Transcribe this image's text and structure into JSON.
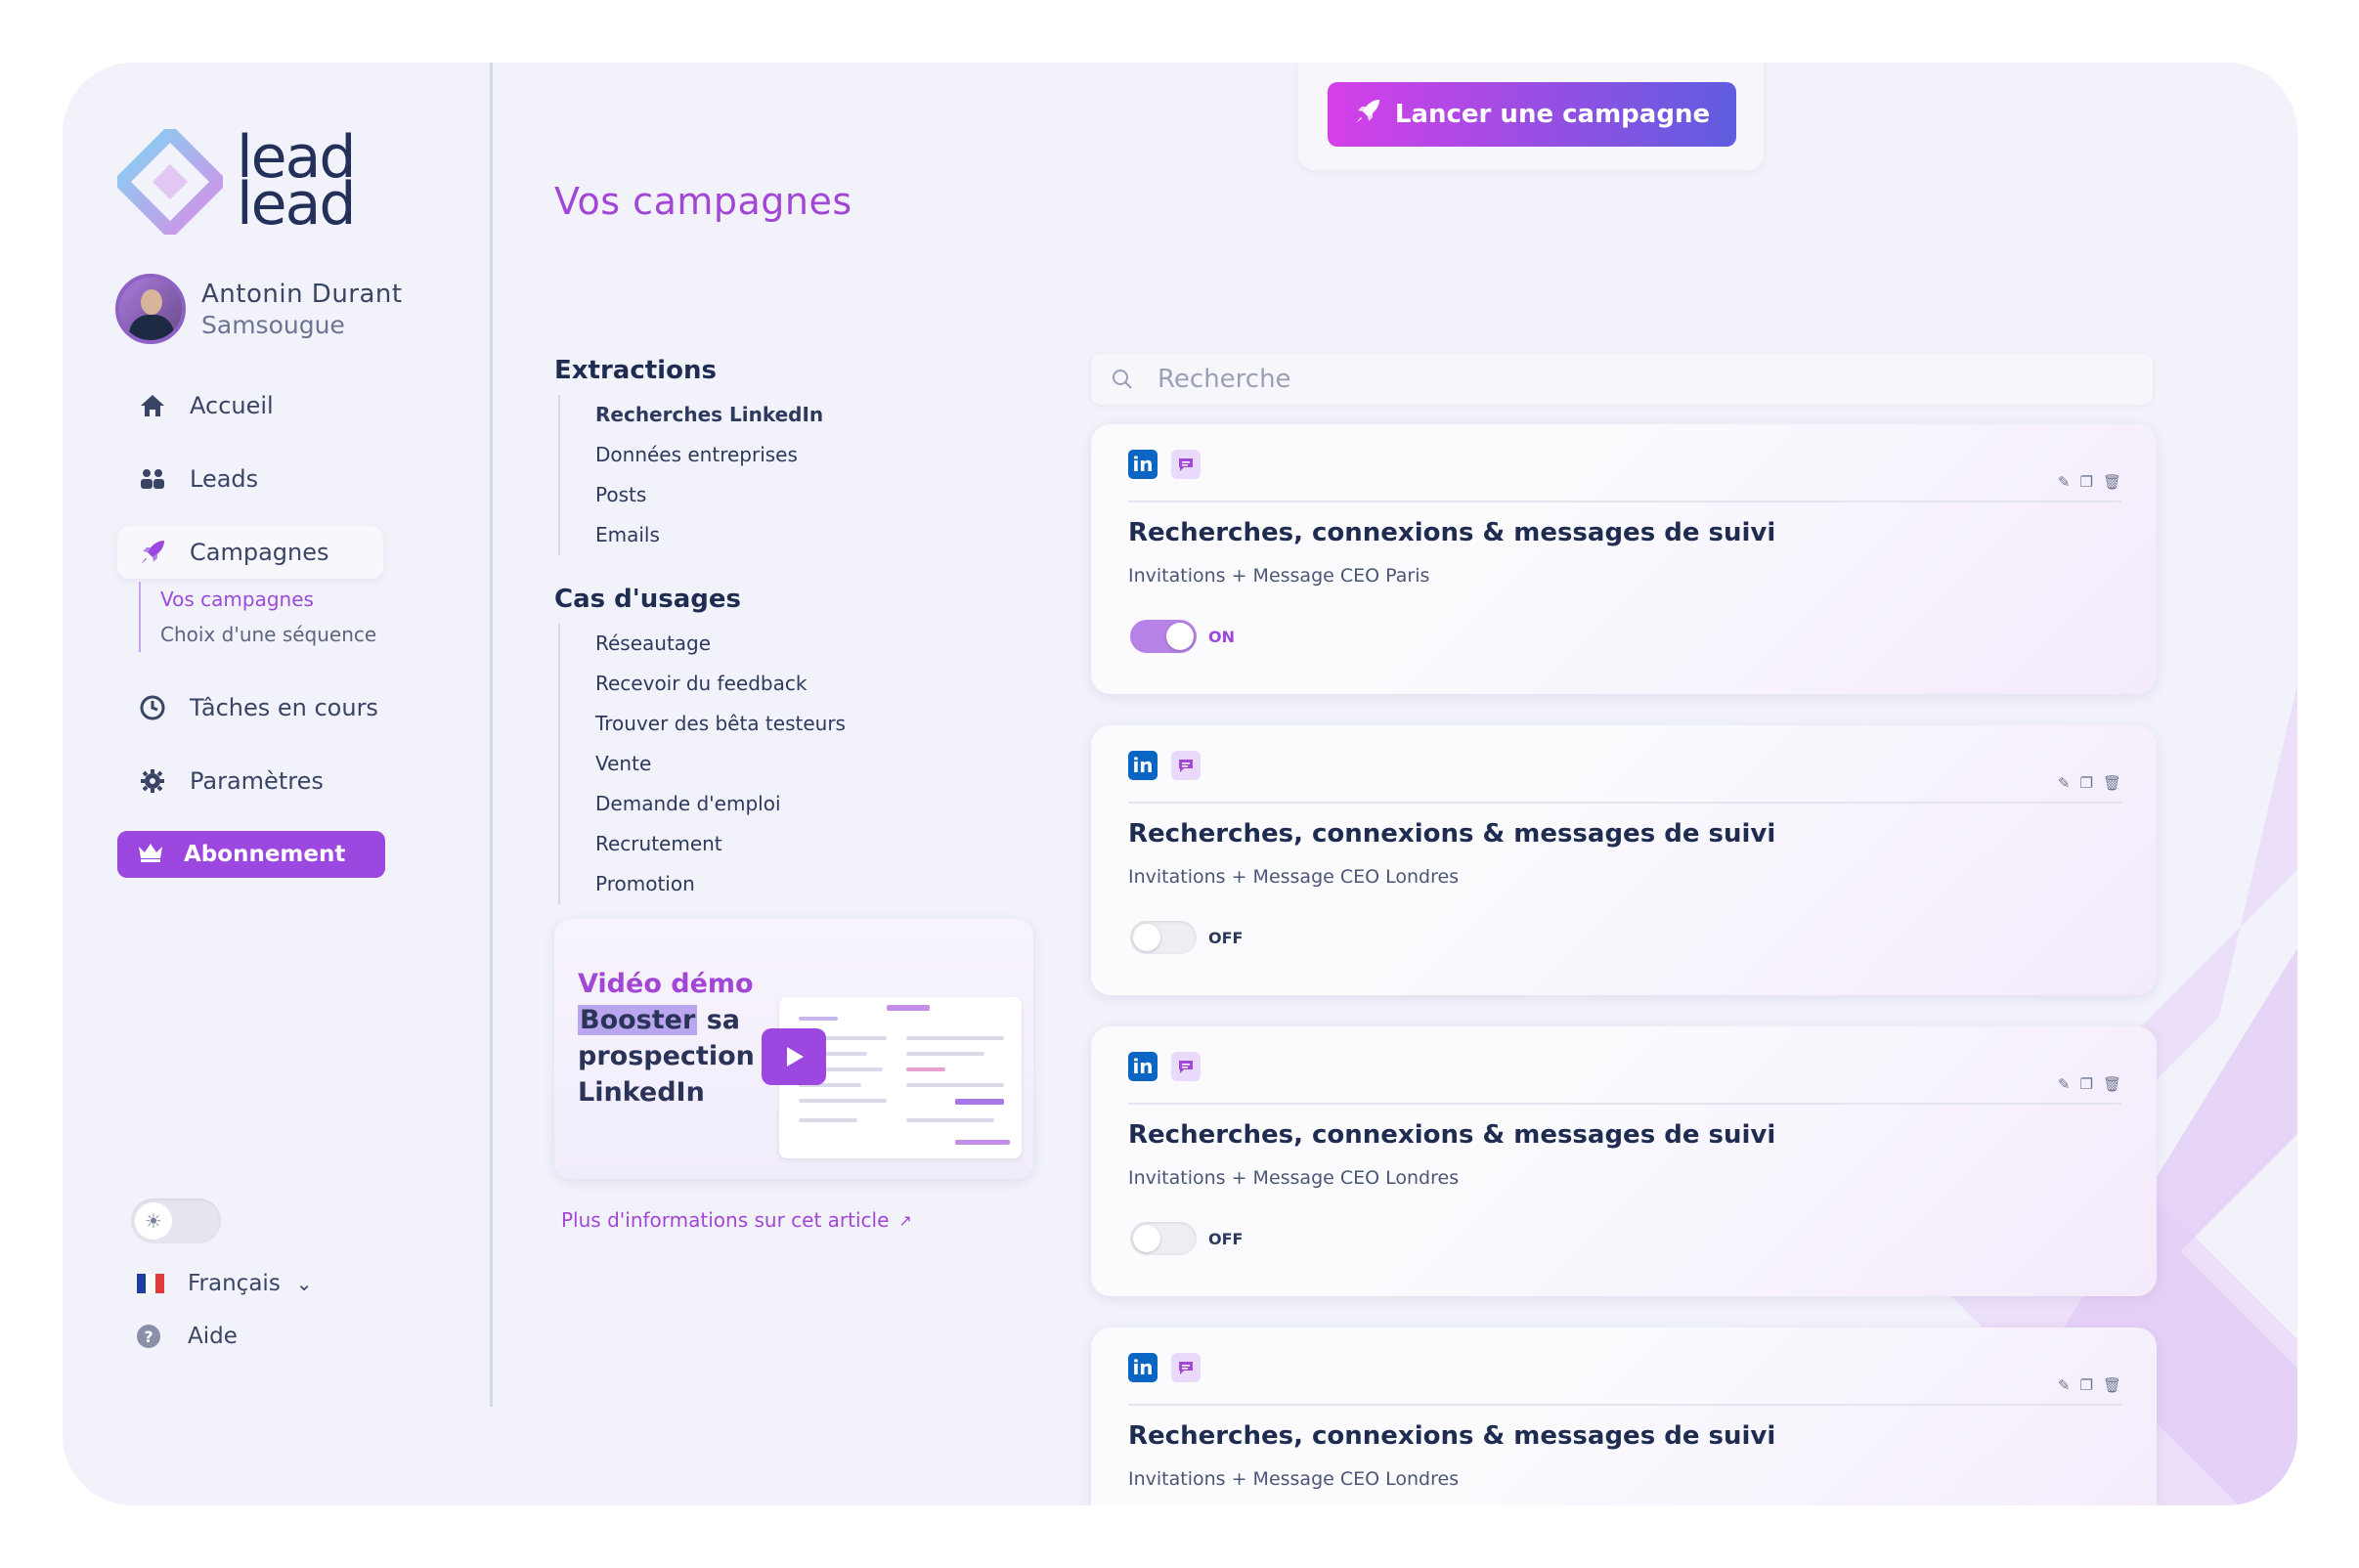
{
  "brand": {
    "logo_line1": "lead",
    "logo_line2": "lead"
  },
  "user": {
    "name": "Antonin Durant",
    "company": "Samsougue"
  },
  "nav": {
    "items": [
      {
        "label": "Accueil",
        "icon": "home-icon"
      },
      {
        "label": "Leads",
        "icon": "users-icon"
      },
      {
        "label": "Campagnes",
        "icon": "rocket-icon",
        "active": true
      },
      {
        "label": "Tâches en cours",
        "icon": "clock-icon"
      },
      {
        "label": "Paramètres",
        "icon": "gear-icon"
      }
    ],
    "sub_items": [
      "Vos campagnes",
      "Choix d'une séquence"
    ],
    "subscribe_label": "Abonnement"
  },
  "footer": {
    "language": "Français",
    "help": "Aide",
    "theme_icon": "sun-icon"
  },
  "launch_button": "Lancer une campagne",
  "page_title": "Vos campagnes",
  "menu": {
    "extractions_title": "Extractions",
    "extractions": [
      "Recherches LinkedIn",
      "Données entreprises",
      "Posts",
      "Emails"
    ],
    "usecases_title": "Cas d'usages",
    "usecases": [
      "Réseautage",
      "Recevoir du feedback",
      "Trouver des bêta testeurs",
      "Vente",
      "Demande d'emploi",
      "Recrutement",
      "Promotion"
    ]
  },
  "video": {
    "line1": "Vidéo démo",
    "highlight": "Booster",
    "line2_rest": " sa",
    "line3": "prospection",
    "line4": "LinkedIn",
    "more_link": "Plus d'informations sur cet article"
  },
  "search": {
    "placeholder": "Recherche"
  },
  "campaigns": [
    {
      "title": "Recherches, connexions & messages de suivi",
      "subtitle": "Invitations + Message CEO Paris",
      "state": "ON"
    },
    {
      "title": "Recherches, connexions & messages de suivi",
      "subtitle": "Invitations + Message CEO Londres",
      "state": "OFF"
    },
    {
      "title": "Recherches, connexions & messages de suivi",
      "subtitle": "Invitations + Message CEO Londres",
      "state": "OFF"
    },
    {
      "title": "Recherches, connexions & messages de suivi",
      "subtitle": "Invitations + Message CEO Londres",
      "state": ""
    }
  ],
  "icons": {
    "linkedin_badge": "in"
  },
  "colors": {
    "accent": "#9b47e0",
    "title": "#a246d6",
    "navy": "#1f2c52",
    "linkedin": "#0a66c2"
  }
}
